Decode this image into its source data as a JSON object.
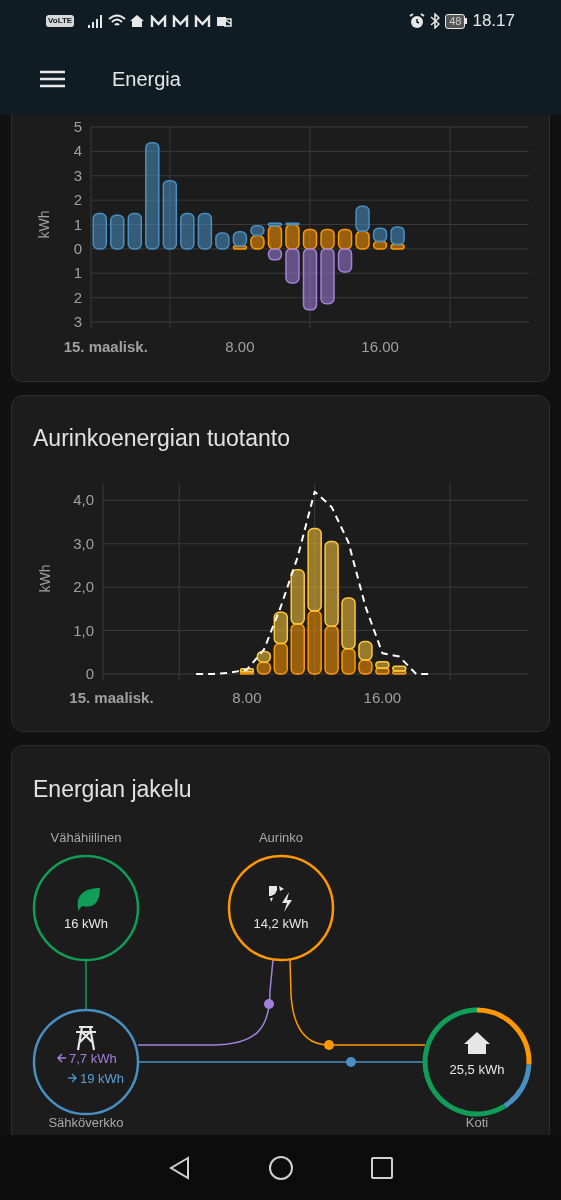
{
  "status_bar": {
    "volte": "VoLTE",
    "battery": "48",
    "time": "18.17"
  },
  "app_bar": {
    "title": "Energia"
  },
  "usage_card": {
    "date_label": "15. maalisk.",
    "chart_data": {
      "type": "bar",
      "stacked": true,
      "grid": true,
      "ylabel": "kWh",
      "x": [
        0,
        1,
        2,
        3,
        4,
        5,
        6,
        7,
        8,
        9,
        10,
        11,
        12,
        13,
        14,
        15,
        16,
        17
      ],
      "xlim": [
        -0.5,
        24.5
      ],
      "ylim": [
        -3,
        5
      ],
      "xticks": [
        {
          "value": 8,
          "label": "8.00"
        },
        {
          "value": 16,
          "label": "16.00"
        }
      ],
      "yticks": [
        {
          "value": 5,
          "label": "5"
        },
        {
          "value": 4,
          "label": "4"
        },
        {
          "value": 3,
          "label": "3"
        },
        {
          "value": 2,
          "label": "2"
        },
        {
          "value": 1,
          "label": "1"
        },
        {
          "value": 0,
          "label": "0"
        },
        {
          "value": -1,
          "label": "1"
        },
        {
          "value": -2,
          "label": "2"
        },
        {
          "value": -3,
          "label": "3"
        }
      ],
      "series": [
        {
          "type": "bar",
          "color": "#ff9800",
          "values": [
            null,
            null,
            null,
            null,
            null,
            null,
            null,
            null,
            0.12,
            0.55,
            0.95,
            1.0,
            0.8,
            0.8,
            0.8,
            0.72,
            0.3,
            0.18
          ]
        },
        {
          "type": "bar",
          "color": "#488fc2",
          "values": [
            1.45,
            1.38,
            1.45,
            4.35,
            2.8,
            1.45,
            1.45,
            0.65,
            0.58,
            0.4,
            0.1,
            0.05,
            null,
            null,
            null,
            1.03,
            0.55,
            0.72
          ]
        },
        {
          "type": "bar",
          "color": "#a280db",
          "values": [
            null,
            null,
            null,
            null,
            null,
            null,
            null,
            null,
            null,
            null,
            -0.45,
            -1.4,
            -2.5,
            -2.25,
            -0.95,
            null,
            null,
            null
          ]
        }
      ]
    }
  },
  "solar_card": {
    "title": "Aurinkoenergian tuotanto",
    "date_label": "15. maalisk.",
    "chart_data": {
      "type": "bar",
      "stacked": true,
      "grid": true,
      "ylabel": "kWh",
      "x": [
        5,
        6,
        7,
        8,
        9,
        10,
        11,
        12,
        13,
        14,
        15,
        16,
        17,
        18,
        19
      ],
      "xlim": [
        -0.5,
        24.6
      ],
      "ylim": [
        0,
        4.4
      ],
      "xticks": [
        {
          "value": 8,
          "label": "8.00"
        },
        {
          "value": 16,
          "label": "16.00"
        }
      ],
      "yticks": [
        {
          "value": 0,
          "label": "0"
        },
        {
          "value": 1,
          "label": "1,0"
        },
        {
          "value": 2,
          "label": "2,0"
        },
        {
          "value": 3,
          "label": "3,0"
        },
        {
          "value": 4,
          "label": "4,0"
        }
      ],
      "series": [
        {
          "type": "bar",
          "color": "#ff9800",
          "values": [
            null,
            null,
            null,
            0.05,
            0.27,
            0.7,
            1.15,
            1.45,
            1.1,
            0.58,
            0.32,
            0.13,
            0.07,
            null,
            null
          ]
        },
        {
          "type": "bar",
          "color": "#ffc83d",
          "values": [
            null,
            null,
            null,
            0.07,
            0.25,
            0.72,
            1.25,
            1.9,
            1.95,
            1.17,
            0.43,
            0.15,
            0.11,
            null,
            null
          ]
        },
        {
          "type": "line",
          "line_style": "dashed",
          "color": "#ffffff",
          "values": [
            0,
            0,
            0.03,
            0.1,
            0.56,
            1.55,
            2.7,
            4.2,
            3.85,
            3.03,
            1.55,
            0.48,
            0.4,
            0,
            0
          ]
        }
      ]
    }
  },
  "distribution_card": {
    "title": "Energian jakelu",
    "low_carbon": {
      "label": "Vähähiilinen",
      "value": "16 kWh"
    },
    "solar": {
      "label": "Aurinko",
      "value": "14,2 kWh"
    },
    "grid": {
      "label": "Sähköverkko",
      "returned": "7,7 kWh",
      "consumed": "19 kWh"
    },
    "home": {
      "label": "Koti",
      "value": "25,5 kWh"
    }
  }
}
